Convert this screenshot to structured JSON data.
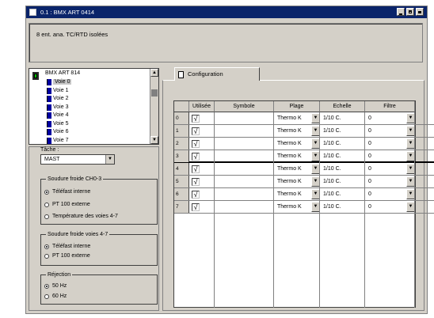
{
  "window": {
    "title": "0.1 : BMX ART 0414"
  },
  "description": "8 ent. ana. TC/RTD isolées",
  "tree": {
    "root": "BMX ART 814",
    "items": [
      "Voie 0",
      "Voie 1",
      "Voie 2",
      "Voie 3",
      "Voie 4",
      "Voie 5",
      "Voie 6",
      "Voie 7"
    ],
    "selected": "Voie 0"
  },
  "task": {
    "label": "Tâche :",
    "value": "MAST"
  },
  "cold_junction_03": {
    "title": "Soudure froide CH0-3",
    "options": [
      "Téléfast interne",
      "PT 100 externe",
      "Température des voies 4-7"
    ],
    "selected": "Téléfast interne"
  },
  "cold_junction_47": {
    "title": "Soudure froide voies 4-7",
    "options": [
      "Téléfast interne",
      "PT 100 externe"
    ],
    "selected": "Téléfast interne"
  },
  "rejection": {
    "title": "Réjection",
    "options": [
      "50 Hz",
      "60 Hz"
    ],
    "selected": "50 Hz"
  },
  "tab": {
    "label": "Configuration"
  },
  "table": {
    "headers": {
      "used": "Utilisée",
      "symbol": "Symbole",
      "range": "Plage",
      "scale": "Echelle",
      "filter": "Filtre"
    },
    "rows": [
      {
        "n": "0",
        "used": "√",
        "symbol": "",
        "range": "Thermo K",
        "scale": "1/10 C.",
        "filter": "0"
      },
      {
        "n": "1",
        "used": "√",
        "symbol": "",
        "range": "Thermo K",
        "scale": "1/10 C.",
        "filter": "0"
      },
      {
        "n": "2",
        "used": "√",
        "symbol": "",
        "range": "Thermo K",
        "scale": "1/10 C.",
        "filter": "0"
      },
      {
        "n": "3",
        "used": "√",
        "symbol": "",
        "range": "Thermo K",
        "scale": "1/10 C.",
        "filter": "0"
      },
      {
        "n": "4",
        "used": "√",
        "symbol": "",
        "range": "Thermo K",
        "scale": "1/10 C.",
        "filter": "0"
      },
      {
        "n": "5",
        "used": "√",
        "symbol": "",
        "range": "Thermo K",
        "scale": "1/10 C.",
        "filter": "0"
      },
      {
        "n": "6",
        "used": "√",
        "symbol": "",
        "range": "Thermo K",
        "scale": "1/10 C.",
        "filter": "0"
      },
      {
        "n": "7",
        "used": "√",
        "symbol": "",
        "range": "Thermo K",
        "scale": "1/10 C.",
        "filter": "0"
      }
    ]
  },
  "icons": {
    "system": "module-icon",
    "minimize": "minimize-icon",
    "maximize": "maximize-icon",
    "close": "close-icon",
    "dropdown": "dropdown-arrow-icon",
    "channel": "channel-icon",
    "tab": "config-page-icon",
    "module": "module-chip-icon"
  },
  "colors": {
    "titlebar": "#0a246a",
    "face": "#d4d0c8"
  }
}
